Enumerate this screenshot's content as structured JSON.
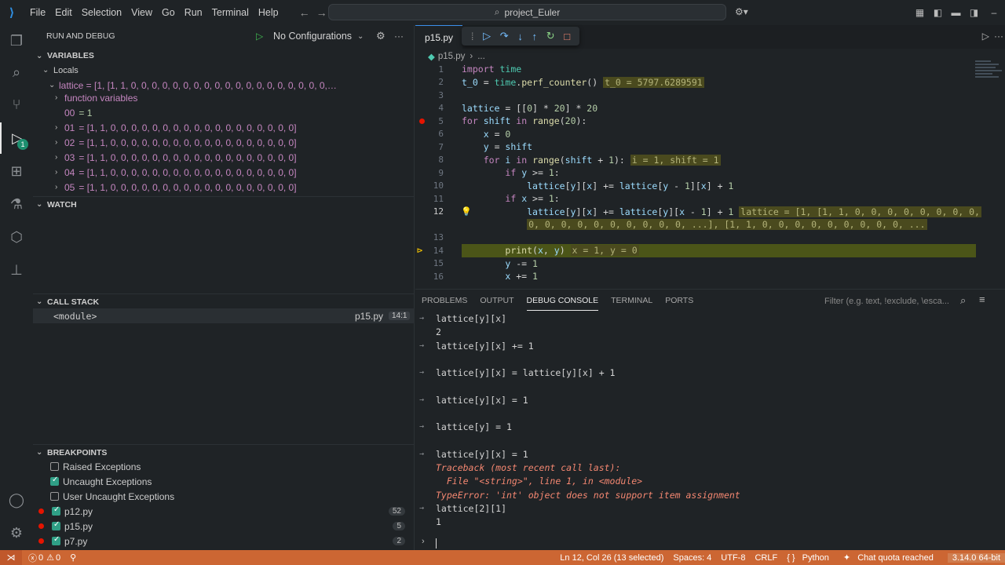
{
  "menu": [
    "File",
    "Edit",
    "Selection",
    "View",
    "Go",
    "Run",
    "Terminal",
    "Help"
  ],
  "search": {
    "text": "project_Euler"
  },
  "sidebar": {
    "title": "RUN AND DEBUG",
    "config": "No Configurations",
    "variables_title": "VARIABLES",
    "locals_label": "Locals",
    "lattice_row": "lattice = [1, [1, 1, 0, 0, 0, 0, 0, 0, 0, 0, 0, 0, 0, 0, 0, 0, 0, 0, 0, 0, 0,…",
    "function_vars": "function variables",
    "rows": [
      {
        "k": "00",
        "v": "= 1"
      },
      {
        "k": "01",
        "v": "= [1, 1, 0, 0, 0, 0, 0, 0, 0, 0, 0, 0, 0, 0, 0, 0, 0, 0, 0, 0]"
      },
      {
        "k": "02",
        "v": "= [1, 1, 0, 0, 0, 0, 0, 0, 0, 0, 0, 0, 0, 0, 0, 0, 0, 0, 0, 0]"
      },
      {
        "k": "03",
        "v": "= [1, 1, 0, 0, 0, 0, 0, 0, 0, 0, 0, 0, 0, 0, 0, 0, 0, 0, 0, 0]"
      },
      {
        "k": "04",
        "v": "= [1, 1, 0, 0, 0, 0, 0, 0, 0, 0, 0, 0, 0, 0, 0, 0, 0, 0, 0, 0]"
      },
      {
        "k": "05",
        "v": "= [1, 1, 0, 0, 0, 0, 0, 0, 0, 0, 0, 0, 0, 0, 0, 0, 0, 0, 0, 0]"
      }
    ],
    "watch_title": "WATCH",
    "callstack_title": "CALL STACK",
    "callstack": {
      "frame": "<module>",
      "file": "p15.py",
      "pos": "14:1"
    },
    "breakpoints_title": "BREAKPOINTS",
    "bp_options": [
      "Raised Exceptions",
      "Uncaught Exceptions",
      "User Uncaught Exceptions"
    ],
    "bp_files": [
      {
        "name": "p12.py",
        "count": "52"
      },
      {
        "name": "p15.py",
        "count": "5"
      },
      {
        "name": "p7.py",
        "count": "2"
      }
    ]
  },
  "activity_badge": "1",
  "editor": {
    "tab": "p15.py",
    "breadcrumb_file": "p15.py",
    "breadcrumb_more": "...",
    "lines": {
      "n1": "1",
      "n2": "2",
      "n3": "3",
      "n4": "4",
      "n5": "5",
      "n6": "6",
      "n7": "7",
      "n8": "8",
      "n9": "9",
      "n10": "10",
      "n11": "11",
      "n12": "12",
      "n13": "13",
      "n14": "14",
      "n15": "15",
      "n16": "16",
      "inline2": "t_0 = 5797.6289591",
      "inline8": "i = 1, shift = 1",
      "inline12a": "lattice = [1, [1, 1, 0, 0, 0, 0, 0, 0, 0, 0,",
      "inline12b": "0, 0, 0, 0, 0, 0, 0, 0, 0, 0, ...], [1, 1, 0, 0, 0, 0, 0, 0, 0, 0, 0, ...",
      "inline14": "x = 1, y = 0"
    }
  },
  "panel": {
    "tabs": [
      "PROBLEMS",
      "OUTPUT",
      "DEBUG CONSOLE",
      "TERMINAL",
      "PORTS"
    ],
    "filter_placeholder": "Filter (e.g. text, !exclude, \\esca...",
    "console": [
      "lattice[y][x]",
      "2",
      "lattice[y][x] += 1",
      "lattice[y][x] = lattice[y][x] + 1",
      "lattice[y][x] = 1",
      "lattice[y] = 1",
      "lattice[y][x] = 1",
      "Traceback (most recent call last):",
      "  File \"<string>\", line 1, in <module>",
      "TypeError: 'int' object does not support item assignment",
      "lattice[2][1]",
      "1"
    ]
  },
  "status": {
    "errors": "0",
    "warnings": "0",
    "position": "Ln 12, Col 26 (13 selected)",
    "spaces": "Spaces: 4",
    "encoding": "UTF-8",
    "eol": "CRLF",
    "language": "Python",
    "chat": "Chat quota reached",
    "python": "3.14.0 64-bit"
  }
}
